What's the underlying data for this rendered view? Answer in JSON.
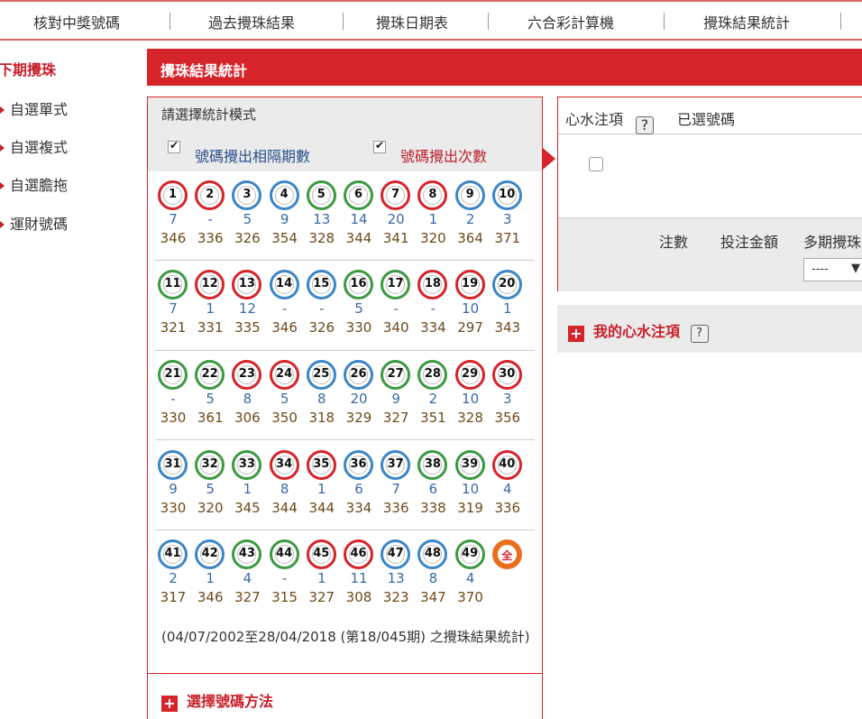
{
  "topnav": {
    "items": [
      "核對中獎號碼",
      "過去攪珠結果",
      "攪珠日期表",
      "六合彩計算機",
      "攪珠結果統計"
    ]
  },
  "leftmenu": {
    "title": "下期攪珠",
    "items": [
      "自選單式",
      "自選複式",
      "自選膽拖",
      "運財號碼"
    ]
  },
  "header": {
    "title": "攪珠結果統計"
  },
  "stats": {
    "mode_label": "請選擇統計模式",
    "option_interval": "號碼攪出相隔期數",
    "option_count": "號碼攪出次數",
    "option_interval_checked": true,
    "option_count_checked": true,
    "colors": {
      "red": "#d6242b",
      "blue": "#3c86c8",
      "green": "#3c9a42",
      "orange": "#ea6e1e"
    },
    "rows": [
      [
        {
          "n": "1",
          "c": "red",
          "g": "7",
          "k": "346"
        },
        {
          "n": "2",
          "c": "red",
          "g": "-",
          "k": "336"
        },
        {
          "n": "3",
          "c": "blue",
          "g": "5",
          "k": "326"
        },
        {
          "n": "4",
          "c": "blue",
          "g": "9",
          "k": "354"
        },
        {
          "n": "5",
          "c": "green",
          "g": "13",
          "k": "328"
        },
        {
          "n": "6",
          "c": "green",
          "g": "14",
          "k": "344"
        },
        {
          "n": "7",
          "c": "red",
          "g": "20",
          "k": "341"
        },
        {
          "n": "8",
          "c": "red",
          "g": "1",
          "k": "320"
        },
        {
          "n": "9",
          "c": "blue",
          "g": "2",
          "k": "364"
        },
        {
          "n": "10",
          "c": "blue",
          "g": "3",
          "k": "371"
        }
      ],
      [
        {
          "n": "11",
          "c": "green",
          "g": "7",
          "k": "321"
        },
        {
          "n": "12",
          "c": "red",
          "g": "1",
          "k": "331"
        },
        {
          "n": "13",
          "c": "red",
          "g": "12",
          "k": "335"
        },
        {
          "n": "14",
          "c": "blue",
          "g": "-",
          "k": "346"
        },
        {
          "n": "15",
          "c": "blue",
          "g": "-",
          "k": "326"
        },
        {
          "n": "16",
          "c": "green",
          "g": "5",
          "k": "330"
        },
        {
          "n": "17",
          "c": "green",
          "g": "-",
          "k": "340"
        },
        {
          "n": "18",
          "c": "red",
          "g": "-",
          "k": "334"
        },
        {
          "n": "19",
          "c": "red",
          "g": "10",
          "k": "297"
        },
        {
          "n": "20",
          "c": "blue",
          "g": "1",
          "k": "343"
        }
      ],
      [
        {
          "n": "21",
          "c": "green",
          "g": "-",
          "k": "330"
        },
        {
          "n": "22",
          "c": "green",
          "g": "5",
          "k": "361"
        },
        {
          "n": "23",
          "c": "red",
          "g": "8",
          "k": "306"
        },
        {
          "n": "24",
          "c": "red",
          "g": "5",
          "k": "350"
        },
        {
          "n": "25",
          "c": "blue",
          "g": "8",
          "k": "318"
        },
        {
          "n": "26",
          "c": "blue",
          "g": "20",
          "k": "329"
        },
        {
          "n": "27",
          "c": "green",
          "g": "9",
          "k": "327"
        },
        {
          "n": "28",
          "c": "green",
          "g": "2",
          "k": "351"
        },
        {
          "n": "29",
          "c": "red",
          "g": "10",
          "k": "328"
        },
        {
          "n": "30",
          "c": "red",
          "g": "3",
          "k": "356"
        }
      ],
      [
        {
          "n": "31",
          "c": "blue",
          "g": "9",
          "k": "330"
        },
        {
          "n": "32",
          "c": "green",
          "g": "5",
          "k": "320"
        },
        {
          "n": "33",
          "c": "green",
          "g": "1",
          "k": "345"
        },
        {
          "n": "34",
          "c": "red",
          "g": "8",
          "k": "344"
        },
        {
          "n": "35",
          "c": "red",
          "g": "1",
          "k": "344"
        },
        {
          "n": "36",
          "c": "blue",
          "g": "6",
          "k": "334"
        },
        {
          "n": "37",
          "c": "blue",
          "g": "7",
          "k": "336"
        },
        {
          "n": "38",
          "c": "green",
          "g": "6",
          "k": "338"
        },
        {
          "n": "39",
          "c": "green",
          "g": "10",
          "k": "319"
        },
        {
          "n": "40",
          "c": "red",
          "g": "4",
          "k": "336"
        }
      ],
      [
        {
          "n": "41",
          "c": "blue",
          "g": "2",
          "k": "317"
        },
        {
          "n": "42",
          "c": "blue",
          "g": "1",
          "k": "346"
        },
        {
          "n": "43",
          "c": "green",
          "g": "4",
          "k": "327"
        },
        {
          "n": "44",
          "c": "green",
          "g": "-",
          "k": "315"
        },
        {
          "n": "45",
          "c": "red",
          "g": "1",
          "k": "327"
        },
        {
          "n": "46",
          "c": "red",
          "g": "11",
          "k": "308"
        },
        {
          "n": "47",
          "c": "blue",
          "g": "13",
          "k": "323"
        },
        {
          "n": "48",
          "c": "blue",
          "g": "8",
          "k": "347"
        },
        {
          "n": "49",
          "c": "green",
          "g": "4",
          "k": "370"
        },
        {
          "n": "全",
          "c": "orange",
          "g": "",
          "k": ""
        }
      ]
    ],
    "footnote": "(04/07/2002至28/04/2018 (第18/045期) 之攪珠結果統計)",
    "select_method": "選擇號碼方法"
  },
  "right": {
    "bet_label": "心水注項",
    "help_icon": "?",
    "selected_label": "已選號碼",
    "col_bets": "注數",
    "col_amount": "投注金額",
    "col_multi": "多期攪珠",
    "dropdown_value": "----",
    "dropdown_arrow": "▼"
  },
  "mybets": {
    "label": "我的心水注項",
    "help_icon": "?"
  }
}
